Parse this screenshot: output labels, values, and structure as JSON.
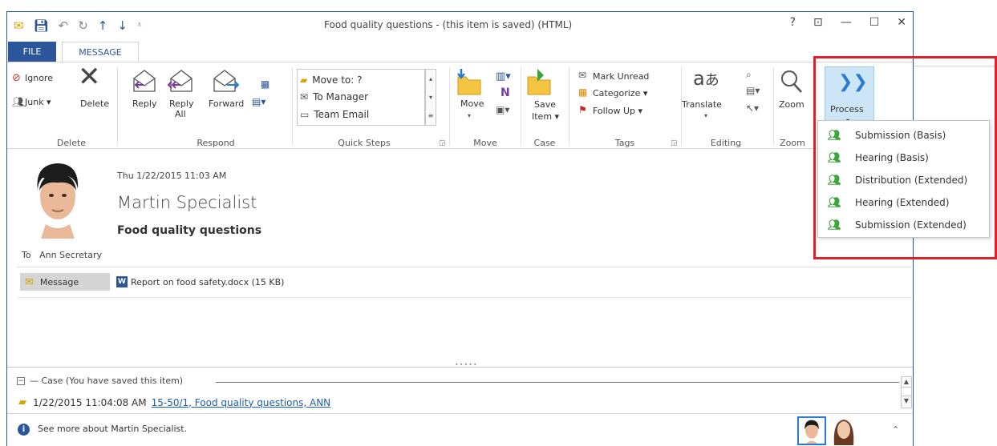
{
  "window": {
    "title": "Food quality questions - (this item is saved) (HTML)",
    "buttons": {
      "help": "?",
      "ribbon_opts": "⊡",
      "minimize": "—",
      "maximize": "☐",
      "close": "✕"
    }
  },
  "tabs": {
    "file": "FILE",
    "message": "MESSAGE"
  },
  "ribbon": {
    "delete_group": {
      "ignore": "Ignore",
      "junk": "Junk ▾",
      "delete": "Delete",
      "label": "Delete"
    },
    "respond_group": {
      "reply": "Reply",
      "reply_all_1": "Reply",
      "reply_all_2": "All",
      "forward": "Forward",
      "label": "Respond"
    },
    "quick_steps": {
      "items": [
        "Move to: ?",
        "To Manager",
        "Team Email"
      ],
      "label": "Quick Steps"
    },
    "move_group": {
      "move": "Move",
      "label": "Move"
    },
    "case_group": {
      "save_1": "Save",
      "save_2": "Item ▾",
      "label": "Case"
    },
    "tags_group": {
      "mark_unread": "Mark Unread",
      "categorize": "Categorize ▾",
      "follow_up": "Follow Up ▾",
      "label": "Tags"
    },
    "editing_group": {
      "translate": "Translate",
      "label": "Editing"
    },
    "zoom_group": {
      "zoom": "Zoom",
      "label": "Zoom"
    },
    "process": {
      "label": "Process"
    }
  },
  "process_menu": {
    "items": [
      "Submission (Basis)",
      "Hearing (Basis)",
      "Distribution (Extended)",
      "Hearing (Extended)",
      "Submission (Extended)"
    ]
  },
  "message": {
    "date": "Thu 1/22/2015 11:03 AM",
    "sender": "Martin Specialist",
    "subject": "Food quality questions",
    "to_label": "To",
    "to": "Ann Secretary",
    "attachments": {
      "message": "Message",
      "doc": "Report on food safety.docx (15 KB)"
    }
  },
  "case_pane": {
    "header": "— Case (You have saved this item)",
    "timestamp": "1/22/2015 11:04:08 AM",
    "link": "15-50/1, Food quality questions, ANN"
  },
  "footer": {
    "see_more": "See more about Martin Specialist."
  },
  "colors": {
    "accent": "#2b579a",
    "highlight_frame": "#e0202a",
    "process_bg": "#cde6f7",
    "link": "#1b5eb3"
  }
}
